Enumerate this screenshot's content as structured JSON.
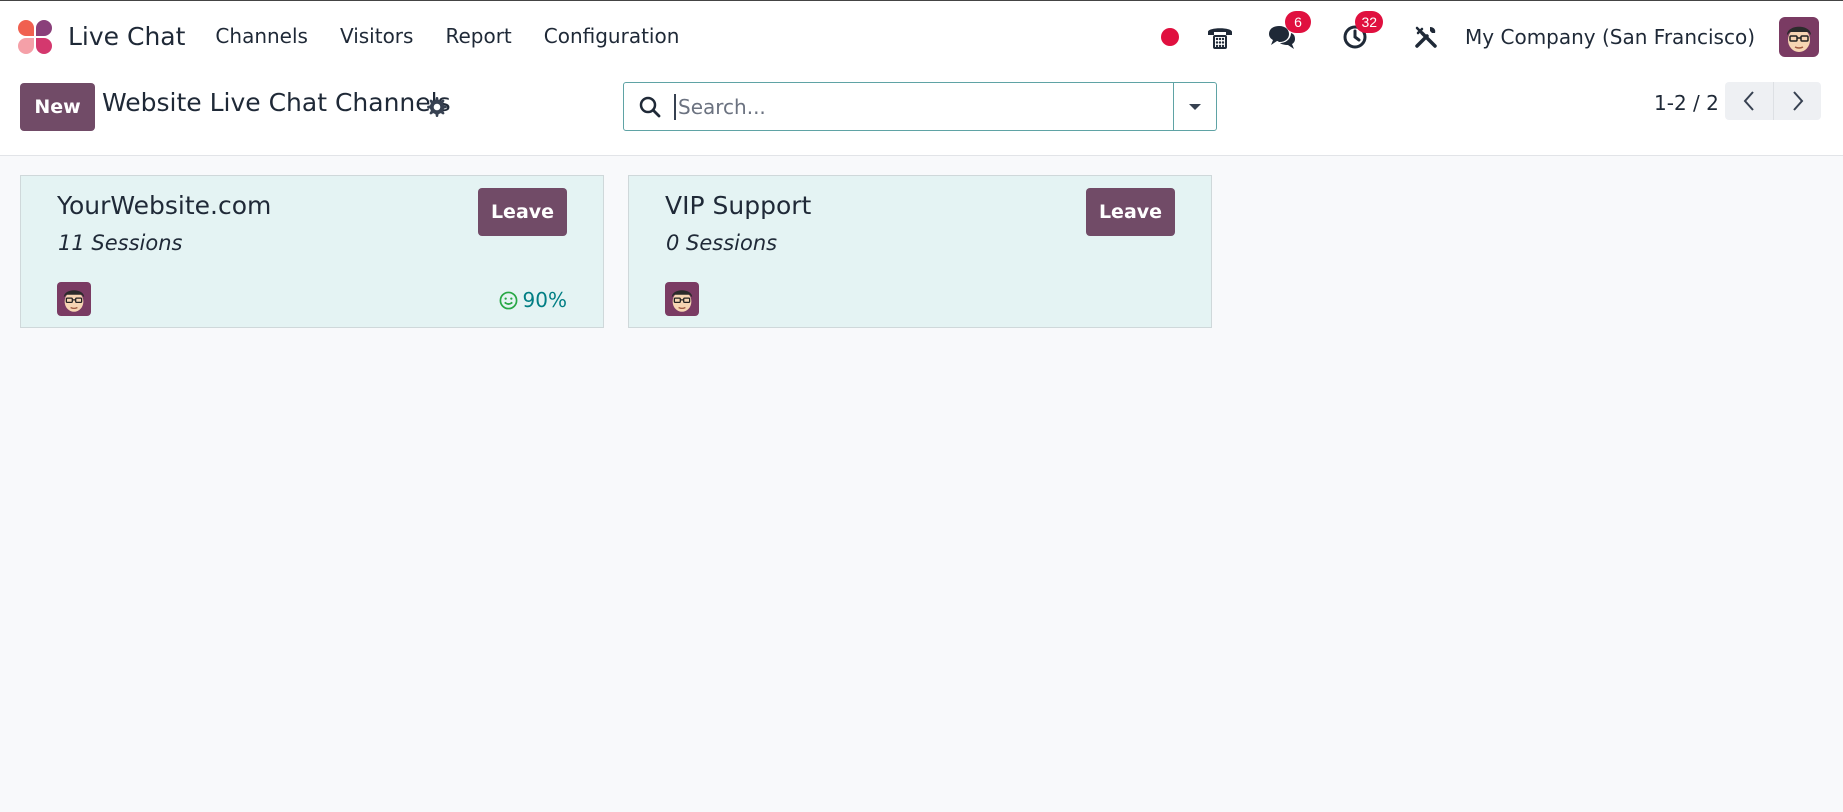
{
  "app": {
    "title": "Live Chat"
  },
  "menu": {
    "channels": "Channels",
    "visitors": "Visitors",
    "report": "Report",
    "configuration": "Configuration"
  },
  "systray": {
    "messages_count": "6",
    "activities_count": "32",
    "company": "My Company (San Francisco)"
  },
  "control_panel": {
    "new_label": "New",
    "title": "Website Live Chat Channels",
    "search_placeholder": "Search...",
    "pager": "1-2 / 2"
  },
  "channels": [
    {
      "name": "YourWebsite.com",
      "sessions": "11 Sessions",
      "leave_label": "Leave",
      "rating": "90%"
    },
    {
      "name": "VIP Support",
      "sessions": "0 Sessions",
      "leave_label": "Leave"
    }
  ],
  "colors": {
    "brand": "#714b67",
    "card_bg": "#e4f3f3",
    "badge": "#e0103f",
    "rating": "#017e84"
  }
}
